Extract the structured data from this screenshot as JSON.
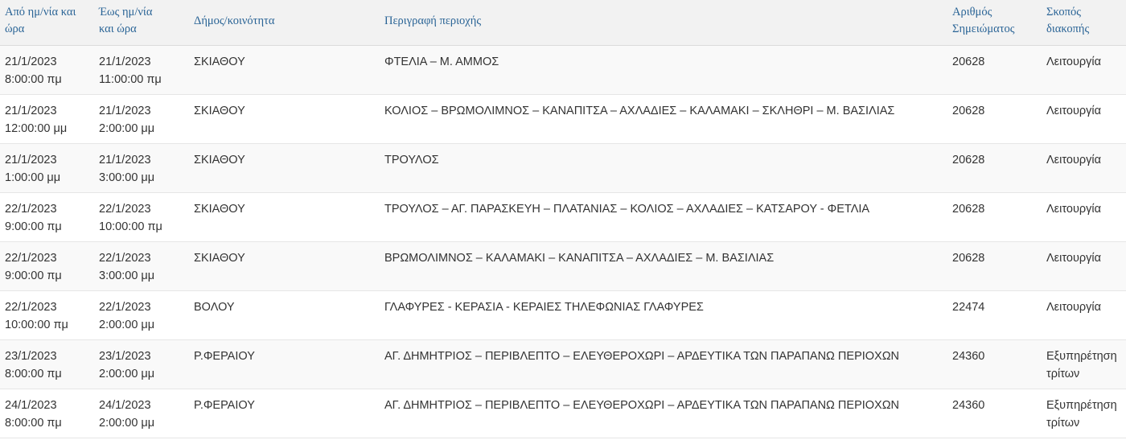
{
  "headers": {
    "from": [
      "Από ημ/νία και",
      "ώρα"
    ],
    "to": [
      "Έως ημ/νία",
      "και ώρα"
    ],
    "municipality": [
      "Δήμος/κοινότητα"
    ],
    "description": [
      "Περιγραφή περιοχής"
    ],
    "point_number": [
      "Αριθμός",
      "Σημειώματος"
    ],
    "purpose": [
      "Σκοπός",
      "διακοπής"
    ]
  },
  "rows": [
    {
      "from_date": "21/1/2023",
      "from_time": "8:00:00 πμ",
      "to_date": "21/1/2023",
      "to_time": "11:00:00 πμ",
      "municipality": "ΣΚΙΑΘΟΥ",
      "description": "ΦΤΕΛΙΑ – Μ. ΑΜΜΟΣ",
      "number": "20628",
      "purpose": [
        "Λειτουργία"
      ]
    },
    {
      "from_date": "21/1/2023",
      "from_time": "12:00:00 μμ",
      "to_date": "21/1/2023",
      "to_time": "2:00:00 μμ",
      "municipality": "ΣΚΙΑΘΟΥ",
      "description": "ΚΟΛΙΟΣ – ΒΡΩΜΟΛΙΜΝΟΣ – ΚΑΝΑΠΙΤΣΑ – ΑΧΛΑΔΙΕΣ – ΚΑΛΑΜΑΚΙ – ΣΚΛΗΘΡΙ – Μ. ΒΑΣΙΛΙΑΣ",
      "number": "20628",
      "purpose": [
        "Λειτουργία"
      ]
    },
    {
      "from_date": "21/1/2023",
      "from_time": "1:00:00 μμ",
      "to_date": "21/1/2023",
      "to_time": "3:00:00 μμ",
      "municipality": "ΣΚΙΑΘΟΥ",
      "description": "ΤΡΟΥΛΟΣ",
      "number": "20628",
      "purpose": [
        "Λειτουργία"
      ]
    },
    {
      "from_date": "22/1/2023",
      "from_time": "9:00:00 πμ",
      "to_date": "22/1/2023",
      "to_time": "10:00:00 πμ",
      "municipality": "ΣΚΙΑΘΟΥ",
      "description": "ΤΡΟΥΛΟΣ – ΑΓ. ΠΑΡΑΣΚΕΥΗ – ΠΛΑΤΑΝΙΑΣ – ΚΟΛΙΟΣ – ΑΧΛΑΔΙΕΣ – ΚΑΤΣΑΡΟΥ - ΦΕΤΛΙΑ",
      "number": "20628",
      "purpose": [
        "Λειτουργία"
      ]
    },
    {
      "from_date": "22/1/2023",
      "from_time": "9:00:00 πμ",
      "to_date": "22/1/2023",
      "to_time": "3:00:00 μμ",
      "municipality": "ΣΚΙΑΘΟΥ",
      "description": "ΒΡΩΜΟΛΙΜΝΟΣ – ΚΑΛΑΜΑΚΙ – ΚΑΝΑΠΙΤΣΑ – ΑΧΛΑΔΙΕΣ – Μ. ΒΑΣΙΛΙΑΣ",
      "number": "20628",
      "purpose": [
        "Λειτουργία"
      ]
    },
    {
      "from_date": "22/1/2023",
      "from_time": "10:00:00 πμ",
      "to_date": "22/1/2023",
      "to_time": "2:00:00 μμ",
      "municipality": "ΒΟΛΟΥ",
      "description": "ΓΛΑΦΥΡΕΣ - ΚΕΡΑΣΙΑ - ΚΕΡΑΙΕΣ ΤΗΛΕΦΩΝΙΑΣ ΓΛΑΦΥΡΕΣ",
      "number": "22474",
      "purpose": [
        "Λειτουργία"
      ]
    },
    {
      "from_date": "23/1/2023",
      "from_time": "8:00:00 πμ",
      "to_date": "23/1/2023",
      "to_time": "2:00:00 μμ",
      "municipality": "Ρ.ΦΕΡΑΙΟΥ",
      "description": "ΑΓ. ΔΗΜΗΤΡΙΟΣ – ΠΕΡΙΒΛΕΠΤΟ – ΕΛΕΥΘΕΡΟΧΩΡΙ – ΑΡΔΕΥΤΙΚΑ ΤΩΝ ΠΑΡΑΠΑΝΩ ΠΕΡΙΟΧΩΝ",
      "number": "24360",
      "purpose": [
        "Εξυπηρέτηση",
        "τρίτων"
      ]
    },
    {
      "from_date": "24/1/2023",
      "from_time": "8:00:00 πμ",
      "to_date": "24/1/2023",
      "to_time": "2:00:00 μμ",
      "municipality": "Ρ.ΦΕΡΑΙΟΥ",
      "description": "ΑΓ. ΔΗΜΗΤΡΙΟΣ – ΠΕΡΙΒΛΕΠΤΟ – ΕΛΕΥΘΕΡΟΧΩΡΙ – ΑΡΔΕΥΤΙΚΑ ΤΩΝ ΠΑΡΑΠΑΝΩ ΠΕΡΙΟΧΩΝ",
      "number": "24360",
      "purpose": [
        "Εξυπηρέτηση",
        "τρίτων"
      ]
    }
  ]
}
